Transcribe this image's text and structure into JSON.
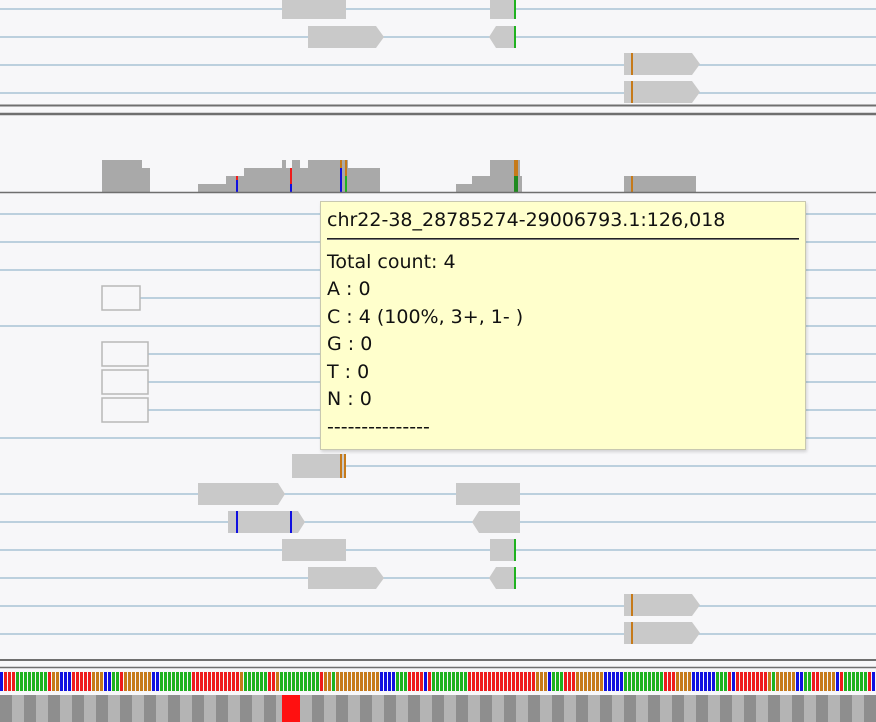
{
  "colors": {
    "background": "#f7f7f9",
    "intron_line": "#a8c4d6",
    "read_fill": "#c9c9c9",
    "read_border": "#b0b0b0",
    "coverage_fill": "#a9a9a9",
    "mismatch_A": "#1fb21f",
    "mismatch_C": "#1010e0",
    "mismatch_G": "#c67a1a",
    "mismatch_T": "#ee1c1c",
    "separator": "#6f6f6f",
    "tooltip_bg": "#ffffcc"
  },
  "icons": [
    "read-right-arrow-icon",
    "read-left-arrow-icon"
  ],
  "tooltip": {
    "title": "chr22-38_28785274-29006793.1:126,018",
    "lines": [
      "Total count: 4",
      "A : 0",
      "C : 4 (100%, 3+, 1- )",
      "G : 0",
      "T : 0",
      "N : 0",
      "---------------"
    ]
  }
}
